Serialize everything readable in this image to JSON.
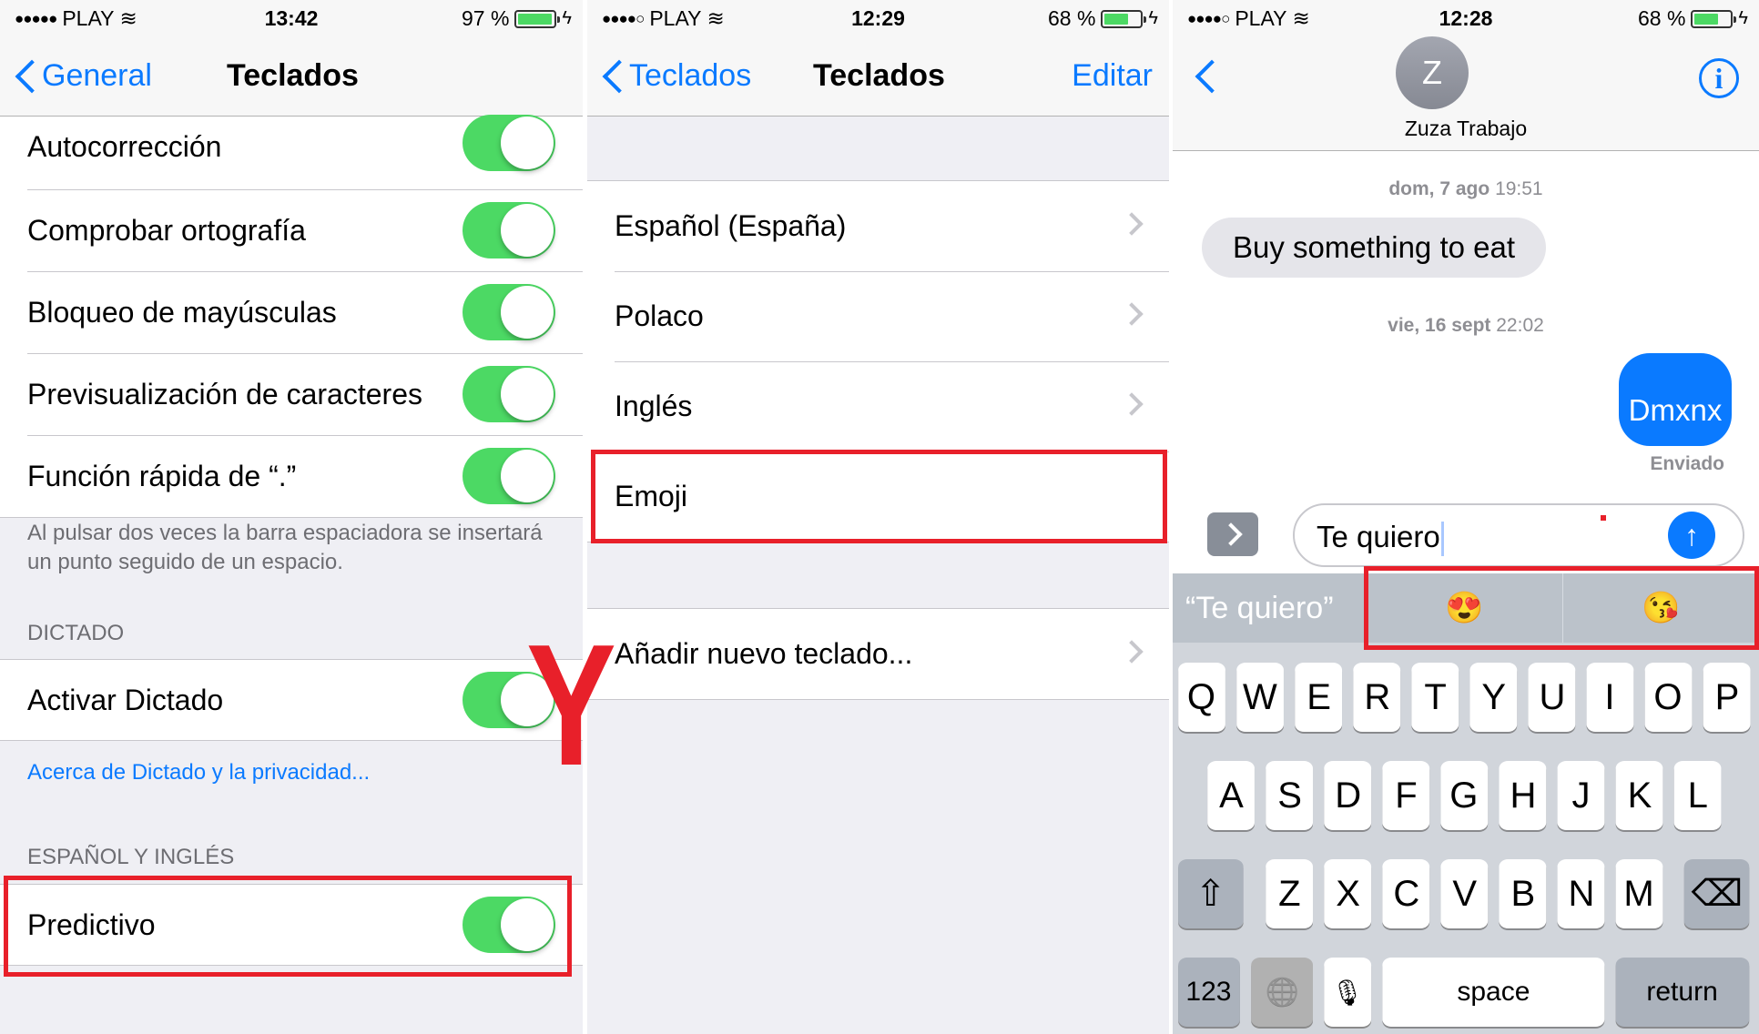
{
  "panels": [
    {
      "status": {
        "signal": "●●●●●",
        "carrier": "PLAY",
        "time": "13:42",
        "battery_pct": "97 %",
        "battery_level": 0.97
      },
      "nav": {
        "back_label": "General",
        "title": "Teclados"
      },
      "toggles": [
        {
          "label": "Autocorrección",
          "on": true
        },
        {
          "label": "Comprobar ortografía",
          "on": true
        },
        {
          "label": "Bloqueo de mayúsculas",
          "on": true
        },
        {
          "label": "Previsualización de caracteres",
          "on": true
        },
        {
          "label": "Función rápida de “.”",
          "on": true
        }
      ],
      "footer_note": "Al pulsar dos veces la barra espaciadora se insertará un punto seguido de un espacio.",
      "dictation_header": "DICTADO",
      "dictation_toggle": {
        "label": "Activar Dictado",
        "on": true
      },
      "dictation_link": "Acerca de Dictado y la privacidad...",
      "lang_header": "ESPAÑOL Y INGLÉS",
      "predictive_toggle": {
        "label": "Predictivo",
        "on": true
      }
    },
    {
      "status": {
        "signal": "●●●●○",
        "carrier": "PLAY",
        "time": "12:29",
        "battery_pct": "68 %",
        "battery_level": 0.68
      },
      "nav": {
        "back_label": "Teclados",
        "title": "Teclados",
        "right_label": "Editar"
      },
      "keyboards": [
        "Español (España)",
        "Polaco",
        "Inglés",
        "Emoji"
      ],
      "add_keyboard": "Añadir nuevo teclado..."
    },
    {
      "status": {
        "signal": "●●●●○",
        "carrier": "PLAY",
        "time": "12:28",
        "battery_pct": "68 %",
        "battery_level": 0.68
      },
      "contact": {
        "initial": "Z",
        "name": "Zuza Trabajo"
      },
      "messages": [
        {
          "timestamp_day": "dom, 7 ago",
          "timestamp_time": "19:51",
          "text": "Buy something to eat",
          "direction": "incoming"
        },
        {
          "timestamp_day": "vie, 16 sept",
          "timestamp_time": "22:02",
          "text": "Dmxnx",
          "direction": "outgoing",
          "status": "Enviado"
        }
      ],
      "input_value": "Te quiero",
      "predictions": [
        "“Te quiero”",
        "😍",
        "😘"
      ],
      "keyboard": {
        "row1": [
          "Q",
          "W",
          "E",
          "R",
          "T",
          "Y",
          "U",
          "I",
          "O",
          "P"
        ],
        "row2": [
          "A",
          "S",
          "D",
          "F",
          "G",
          "H",
          "J",
          "K",
          "L"
        ],
        "row3": [
          "Z",
          "X",
          "C",
          "V",
          "B",
          "N",
          "M"
        ],
        "numbers_label": "123",
        "space_label": "space",
        "return_label": "return"
      }
    }
  ],
  "annotation": {
    "connector_letter": "Y",
    "highlight_color": "#e8202a"
  },
  "colors": {
    "ios_blue": "#0a7aff",
    "toggle_green": "#4cd964",
    "incoming_bubble": "#e5e5ea"
  }
}
